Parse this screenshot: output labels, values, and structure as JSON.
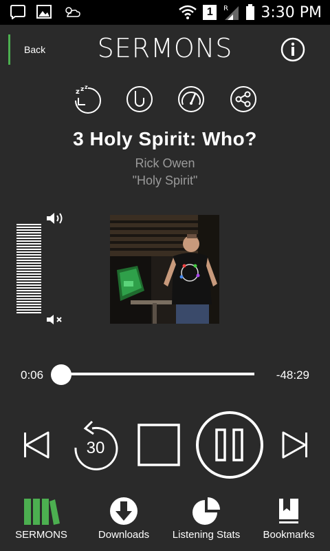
{
  "status_bar": {
    "time": "3:30 PM",
    "sim_label": "1",
    "roaming": "R"
  },
  "header": {
    "back_label": "Back",
    "title": "SERMONS"
  },
  "track": {
    "title": "3 Holy Spirit: Who?",
    "speaker": "Rick Owen",
    "series": "\"Holy Spirit\""
  },
  "volume": {
    "level": 1.0
  },
  "progress": {
    "current": "0:06",
    "remaining": "-48:29",
    "fraction": 0.002
  },
  "controls": {
    "skip_back_seconds": "30"
  },
  "bottom_nav": [
    {
      "label": "SERMONS",
      "icon": "books-icon",
      "active": true
    },
    {
      "label": "Downloads",
      "icon": "download-icon",
      "active": false
    },
    {
      "label": "Listening Stats",
      "icon": "pie-chart-icon",
      "active": false
    },
    {
      "label": "Bookmarks",
      "icon": "bookmark-icon",
      "active": false
    }
  ],
  "colors": {
    "accent": "#4caf50",
    "background": "#2a2a2a",
    "subtext": "#9a9a9a"
  }
}
